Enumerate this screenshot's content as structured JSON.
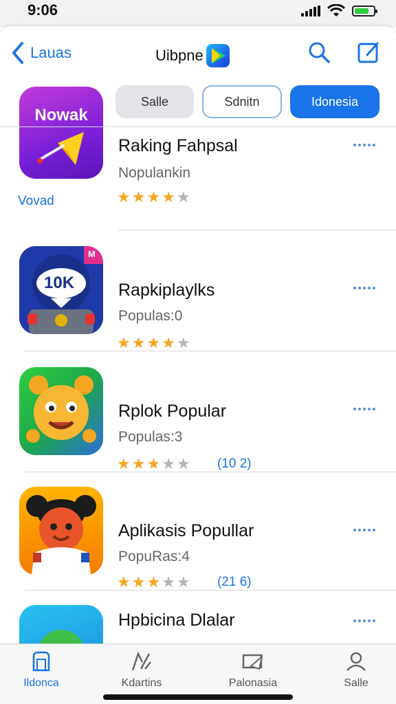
{
  "status": {
    "time": "9:06"
  },
  "nav": {
    "back_label": "Lauas",
    "title": "Uibpne"
  },
  "featured": {
    "icon_text": "Nowak",
    "label": "Vovad"
  },
  "chips": [
    {
      "label": "Salle"
    },
    {
      "label": "Sdnitn"
    },
    {
      "label": "Idonesia"
    }
  ],
  "apps": [
    {
      "name": "Raking Fahpsal",
      "subtitle": "Nopulankin",
      "rating": 4,
      "count": ""
    },
    {
      "name": "Rapkiplaylks",
      "subtitle": "Populas:0",
      "rating": 4,
      "count": "",
      "icon_text": "10K",
      "badge_text": "M"
    },
    {
      "name": "Rplok Popular",
      "subtitle": "Populas:3",
      "rating": 3,
      "count": "(10 2)"
    },
    {
      "name": "Aplikasis Popullar",
      "subtitle": "PopuRas:4",
      "rating": 3,
      "count": "(21 6)"
    },
    {
      "name": "Hpbicina Dlalar",
      "subtitle": "",
      "rating": 0,
      "count": ""
    }
  ],
  "tabs": [
    {
      "label": "Ildonca"
    },
    {
      "label": "Kdartins"
    },
    {
      "label": "Palonasia"
    },
    {
      "label": "Salle"
    }
  ],
  "colors": {
    "accent": "#1a73e8",
    "star": "#f5a623",
    "star_empty": "#b5b5b5"
  }
}
